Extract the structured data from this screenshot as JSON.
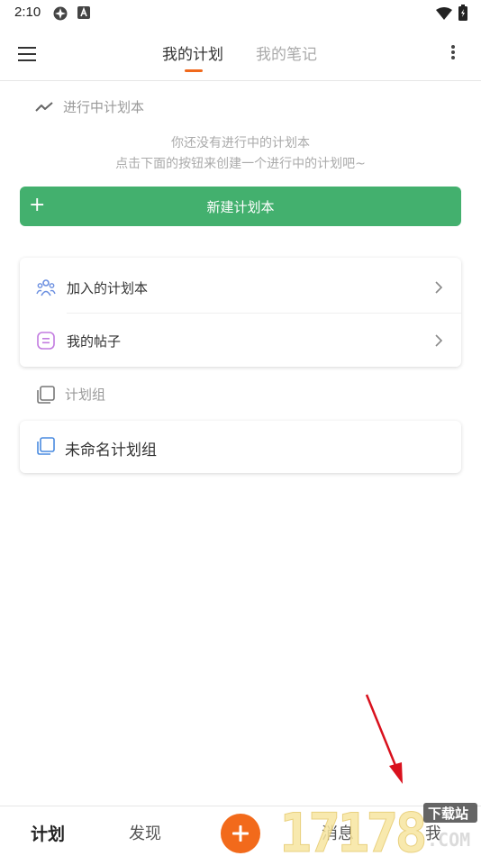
{
  "status_bar": {
    "time": "2:10"
  },
  "tabs": [
    {
      "label": "我的计划",
      "active": true
    },
    {
      "label": "我的笔记",
      "active": false
    }
  ],
  "in_progress": {
    "title": "进行中计划本",
    "empty_line1": "你还没有进行中的计划本",
    "empty_line2": "点击下面的按钮来创建一个进行中的计划吧~",
    "new_button_label": "新建计划本"
  },
  "links": [
    {
      "label": "加入的计划本",
      "icon": "people-icon"
    },
    {
      "label": "我的帖子",
      "icon": "post-icon"
    }
  ],
  "plan_groups": {
    "title": "计划组",
    "items": [
      {
        "label": "未命名计划组"
      }
    ]
  },
  "bottom_nav": {
    "plan": "计划",
    "discover": "发现",
    "messages": "消息",
    "me": "我"
  },
  "watermark": {
    "brand": "17178",
    "tag": "下载站",
    "domain": ".COM"
  },
  "colors": {
    "accent_green": "#43b06e",
    "accent_orange": "#f26a1b",
    "tab_indicator": "#f0691c",
    "annotation_arrow": "#d9111d"
  }
}
